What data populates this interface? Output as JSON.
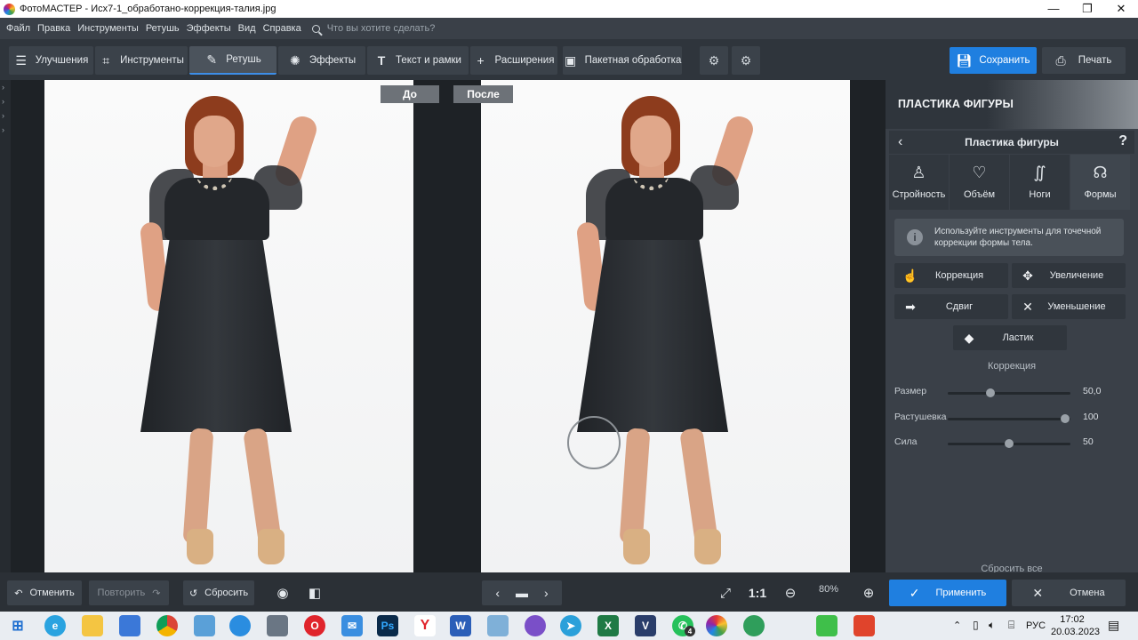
{
  "window": {
    "title": "ФотоМАСТЕР - Исх7-1_обработано-коррекция-талия.jpg",
    "controls": [
      "—",
      "❐",
      "✕"
    ]
  },
  "menu": {
    "items": [
      "Файл",
      "Правка",
      "Инструменты",
      "Ретушь",
      "Эффекты",
      "Вид",
      "Справка"
    ],
    "search_placeholder": "Что вы хотите сделать?"
  },
  "toolbar": {
    "tabs": [
      {
        "label": "Улучшения",
        "icon": "sliders-icon"
      },
      {
        "label": "Инструменты",
        "icon": "crop-icon"
      },
      {
        "label": "Ретушь",
        "icon": "brush-icon",
        "active": true
      },
      {
        "label": "Эффекты",
        "icon": "sparkle-icon"
      },
      {
        "label": "Текст и рамки",
        "icon": "text-icon"
      },
      {
        "label": "Расширения",
        "icon": "plus-icon"
      },
      {
        "label": "Пакетная обработка",
        "icon": "images-icon"
      }
    ],
    "save_label": "Сохранить",
    "print_label": "Печать"
  },
  "canvas": {
    "before_label": "До",
    "after_label": "После"
  },
  "panel": {
    "header_title": "ПЛАСТИКА ФИГУРЫ",
    "sub_title": "Пластика фигуры",
    "help": "?",
    "tabs": [
      {
        "label": "Стройность",
        "icon": "slim-icon"
      },
      {
        "label": "Объём",
        "icon": "volume-icon"
      },
      {
        "label": "Ноги",
        "icon": "legs-icon"
      },
      {
        "label": "Формы",
        "icon": "shapes-icon",
        "active": true
      }
    ],
    "info_text": "Используйте инструменты для точечной коррекции формы тела.",
    "tools": {
      "correction": "Коррекция",
      "increase": "Увеличение",
      "shift": "Сдвиг",
      "decrease": "Уменьшение",
      "eraser": "Ластик"
    },
    "section_title": "Коррекция",
    "sliders": [
      {
        "label": "Размер",
        "value_text": "50,0",
        "fraction": 0.35
      },
      {
        "label": "Растушевка",
        "value_text": "100",
        "fraction": 0.96
      },
      {
        "label": "Сила",
        "value_text": "50",
        "fraction": 0.5
      }
    ],
    "reset_all": "Сбросить все"
  },
  "bottombar": {
    "undo_label": "Отменить",
    "redo_label": "Повторить",
    "reset_label": "Сбросить",
    "zoom_1_1": "1:1",
    "zoom_value": "80%",
    "apply_label": "Применить",
    "cancel_label": "Отмена"
  },
  "taskbar": {
    "lang": "РУС",
    "time": "17:02",
    "date": "20.03.2023",
    "whatsapp_badge": "4",
    "photoshop_label": "Ps",
    "word_label": "W",
    "excel_label": "X",
    "v_label": "V"
  },
  "colors": {
    "accent": "#1f7fe0",
    "panel": "#3a4048",
    "toolbar": "#2f353c"
  }
}
